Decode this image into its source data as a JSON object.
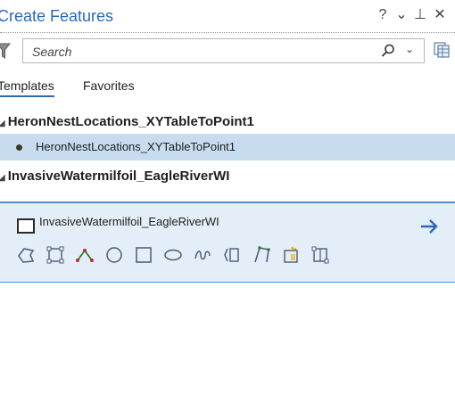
{
  "pane": {
    "title": "Create Features",
    "help_label": "?",
    "options_label": "⌄",
    "pin_label": "⊥",
    "close_label": "✕"
  },
  "search": {
    "placeholder": "Search",
    "dropdown_label": "⌄"
  },
  "tabs": [
    {
      "label": "Templates",
      "active": true
    },
    {
      "label": "Favorites",
      "active": false
    }
  ],
  "groups": [
    {
      "name": "HeronNestLocations_XYTableToPoint1",
      "templates": [
        {
          "label": "HeronNestLocations_XYTableToPoint1",
          "selected": true
        }
      ]
    },
    {
      "name": "InvasiveWatermilfoil_EagleRiverWI",
      "templates": [
        {
          "label": "InvasiveWatermilfoil_EagleRiverWI",
          "selected": false
        }
      ]
    }
  ],
  "construction_tools": [
    "freehand-polygon-icon",
    "polygon-icon",
    "line-tool-icon",
    "circle-icon",
    "rectangle-icon",
    "ellipse-icon",
    "freehand-icon",
    "trace-icon",
    "right-angle-icon",
    "autocomplete-polygon-icon",
    "split-polygon-icon"
  ],
  "colors": {
    "accent": "#2a6ab8",
    "selected_row": "#c8dcf0",
    "panel_bg": "#e4eef8",
    "panel_border": "#4a8fd4"
  }
}
